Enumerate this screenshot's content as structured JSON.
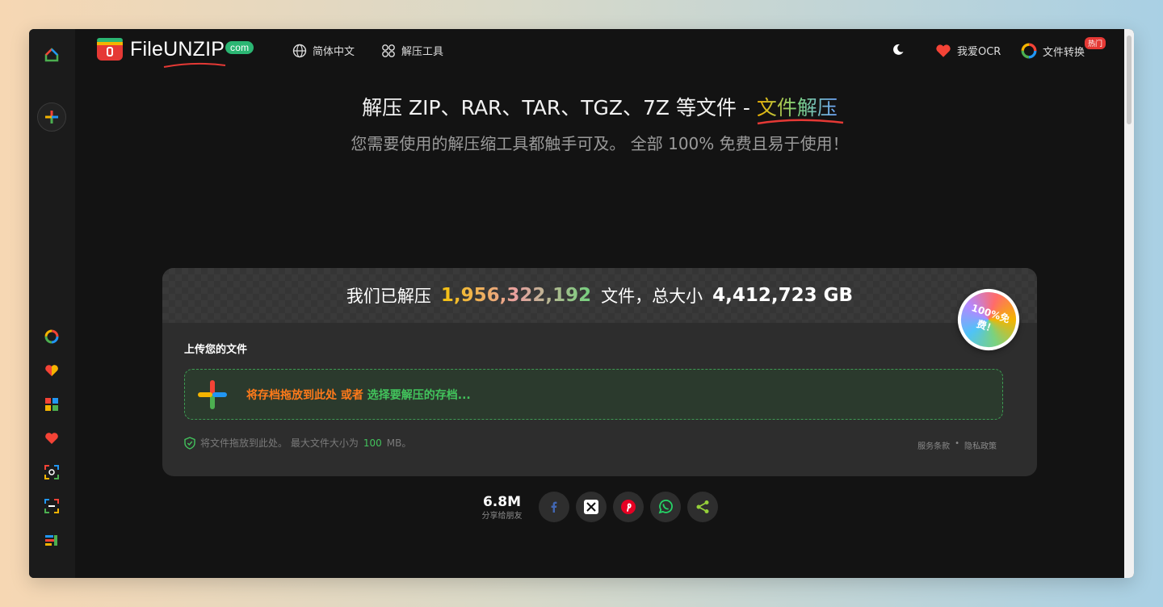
{
  "nav": {
    "logo_text": "FileUNZIP",
    "logo_suffix": "com",
    "language": "简体中文",
    "tools": "解压工具",
    "ocr": "我爱OCR",
    "convert": "文件转换",
    "convert_badge": "热门"
  },
  "hero": {
    "title_main": "解压 ZIP、RAR、TAR、TGZ、7Z 等文件 - ",
    "title_accent": "文件解压",
    "subtitle": "您需要使用的解压缩工具都触手可及。 全部 100% 免费且易于使用！"
  },
  "stats": {
    "prefix": "我们已解压",
    "files_count": "1,956,322,192",
    "middle": "文件，总大小",
    "total_size": "4,412,723 GB",
    "badge": "100%免费！"
  },
  "upload": {
    "label": "上传您的文件",
    "drop_text": "将存档拖放到此处 或者",
    "select_text": "选择要解压的存档...",
    "hint_prefix": "将文件拖放到此处。 最大文件大小为",
    "max_size": "100",
    "hint_suffix": "MB。",
    "terms": "服务条款",
    "dot": "•",
    "privacy": "隐私政策"
  },
  "share": {
    "count": "6.8M",
    "label": "分享给朋友"
  },
  "colors": {
    "accent_green": "#42c35c",
    "accent_orange": "#ff7a1a",
    "background": "#131313",
    "card": "#2d2d2d"
  }
}
